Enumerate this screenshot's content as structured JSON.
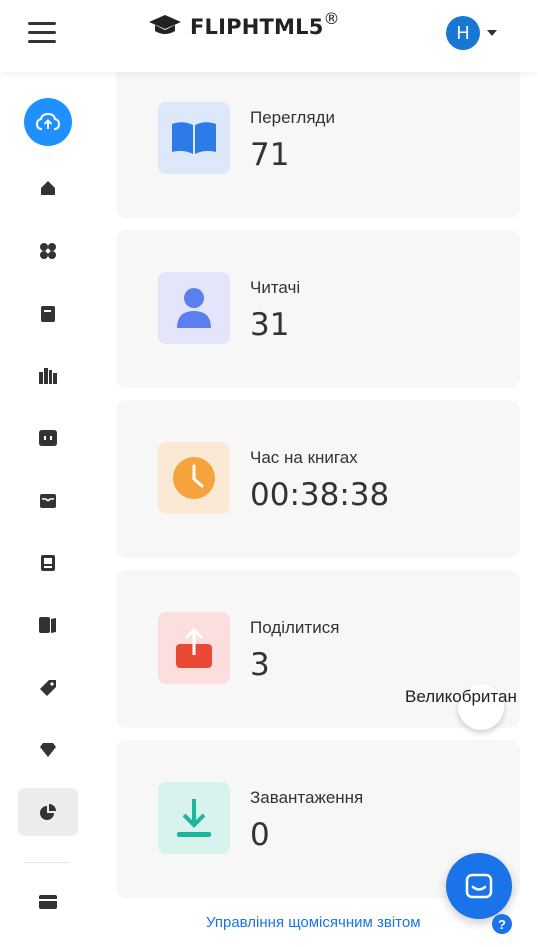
{
  "header": {
    "logo_text": "FLIPHTML5",
    "logo_mark": "®",
    "avatar_initial": "H"
  },
  "sidebar": {
    "items": [
      {
        "icon": "cloud-upload-icon"
      },
      {
        "icon": "home-icon"
      },
      {
        "icon": "fan-icon"
      },
      {
        "icon": "book-icon"
      },
      {
        "icon": "library-icon"
      },
      {
        "icon": "chat-bubble-icon"
      },
      {
        "icon": "inbox-icon"
      },
      {
        "icon": "gallery-icon"
      },
      {
        "icon": "bookshelf-icon"
      },
      {
        "icon": "tag-icon"
      },
      {
        "icon": "diamond-icon"
      },
      {
        "icon": "pie-chart-icon"
      },
      {
        "icon": "wallet-icon"
      }
    ],
    "active_index": 11
  },
  "stats": [
    {
      "label": "Перегляди",
      "value": "71",
      "icon": "open-book-icon",
      "bg": "#dde9fb",
      "color": "#2d7be8"
    },
    {
      "label": "Читачі",
      "value": "31",
      "icon": "person-icon",
      "bg": "#e3e6fb",
      "color": "#5b7fee"
    },
    {
      "label": "Час на книгах",
      "value": "00:38:38",
      "icon": "clock-icon",
      "bg": "#fbe9d5",
      "color": "#f5a33b"
    },
    {
      "label": "Поділитися",
      "value": "3",
      "icon": "share-icon",
      "bg": "#fbdede",
      "color": "#ea4a35"
    },
    {
      "label": "Завантаження",
      "value": "0",
      "icon": "download-icon",
      "bg": "#d8f3ee",
      "color": "#1db59b"
    }
  ],
  "tooltip_text": "Великобритан",
  "footer": {
    "link": "Управління щомісячним звітом",
    "help": "?"
  }
}
